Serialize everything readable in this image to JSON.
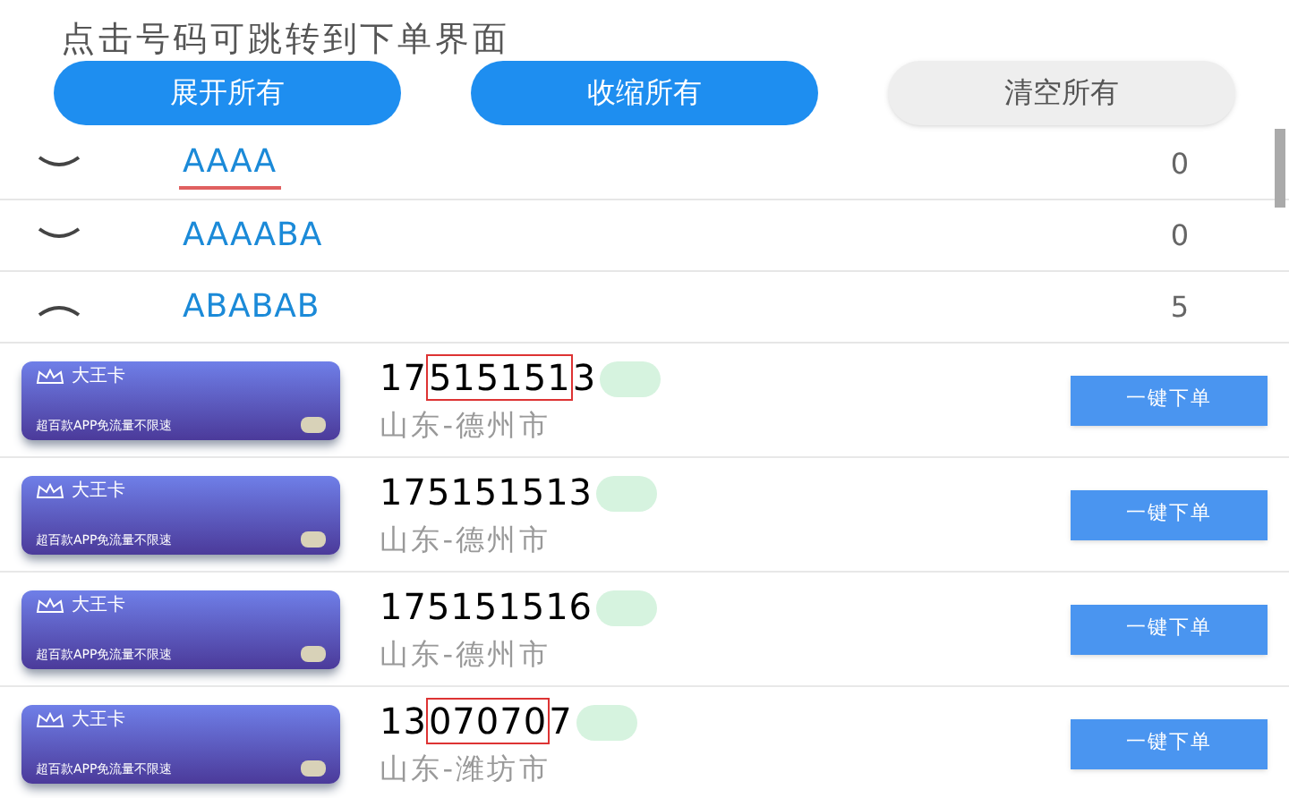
{
  "header": {
    "title": "点击号码可跳转到下单界面"
  },
  "actions": [
    {
      "label": "展开所有",
      "kind": "primary"
    },
    {
      "label": "收缩所有",
      "kind": "primary"
    },
    {
      "label": "清空所有",
      "kind": "secondary"
    }
  ],
  "groups": [
    {
      "name": "AAAA",
      "count": "0",
      "expanded": false,
      "underlined": true
    },
    {
      "name": "AAAABA",
      "count": "0",
      "expanded": false,
      "underlined": false
    },
    {
      "name": "ABABAB",
      "count": "5",
      "expanded": true,
      "underlined": false,
      "items": [
        {
          "card_title": "大王卡",
          "card_slogan": "超百款APP免流量不限速",
          "number_prefix": "17",
          "number_highlight": "515151",
          "number_suffix": "3",
          "location": "山东-德州市",
          "button": "一键下单"
        },
        {
          "card_title": "大王卡",
          "card_slogan": "超百款APP免流量不限速",
          "number_prefix": "175151513",
          "location": "山东-德州市",
          "button": "一键下单"
        },
        {
          "card_title": "大王卡",
          "card_slogan": "超百款APP免流量不限速",
          "number_prefix": "175151516",
          "location": "山东-德州市",
          "button": "一键下单"
        },
        {
          "card_title": "大王卡",
          "card_slogan": "超百款APP免流量不限速",
          "number_prefix": "13",
          "number_highlight": "07070",
          "number_suffix": "7",
          "location": "山东-潍坊市",
          "button": "一键下单"
        }
      ]
    }
  ]
}
